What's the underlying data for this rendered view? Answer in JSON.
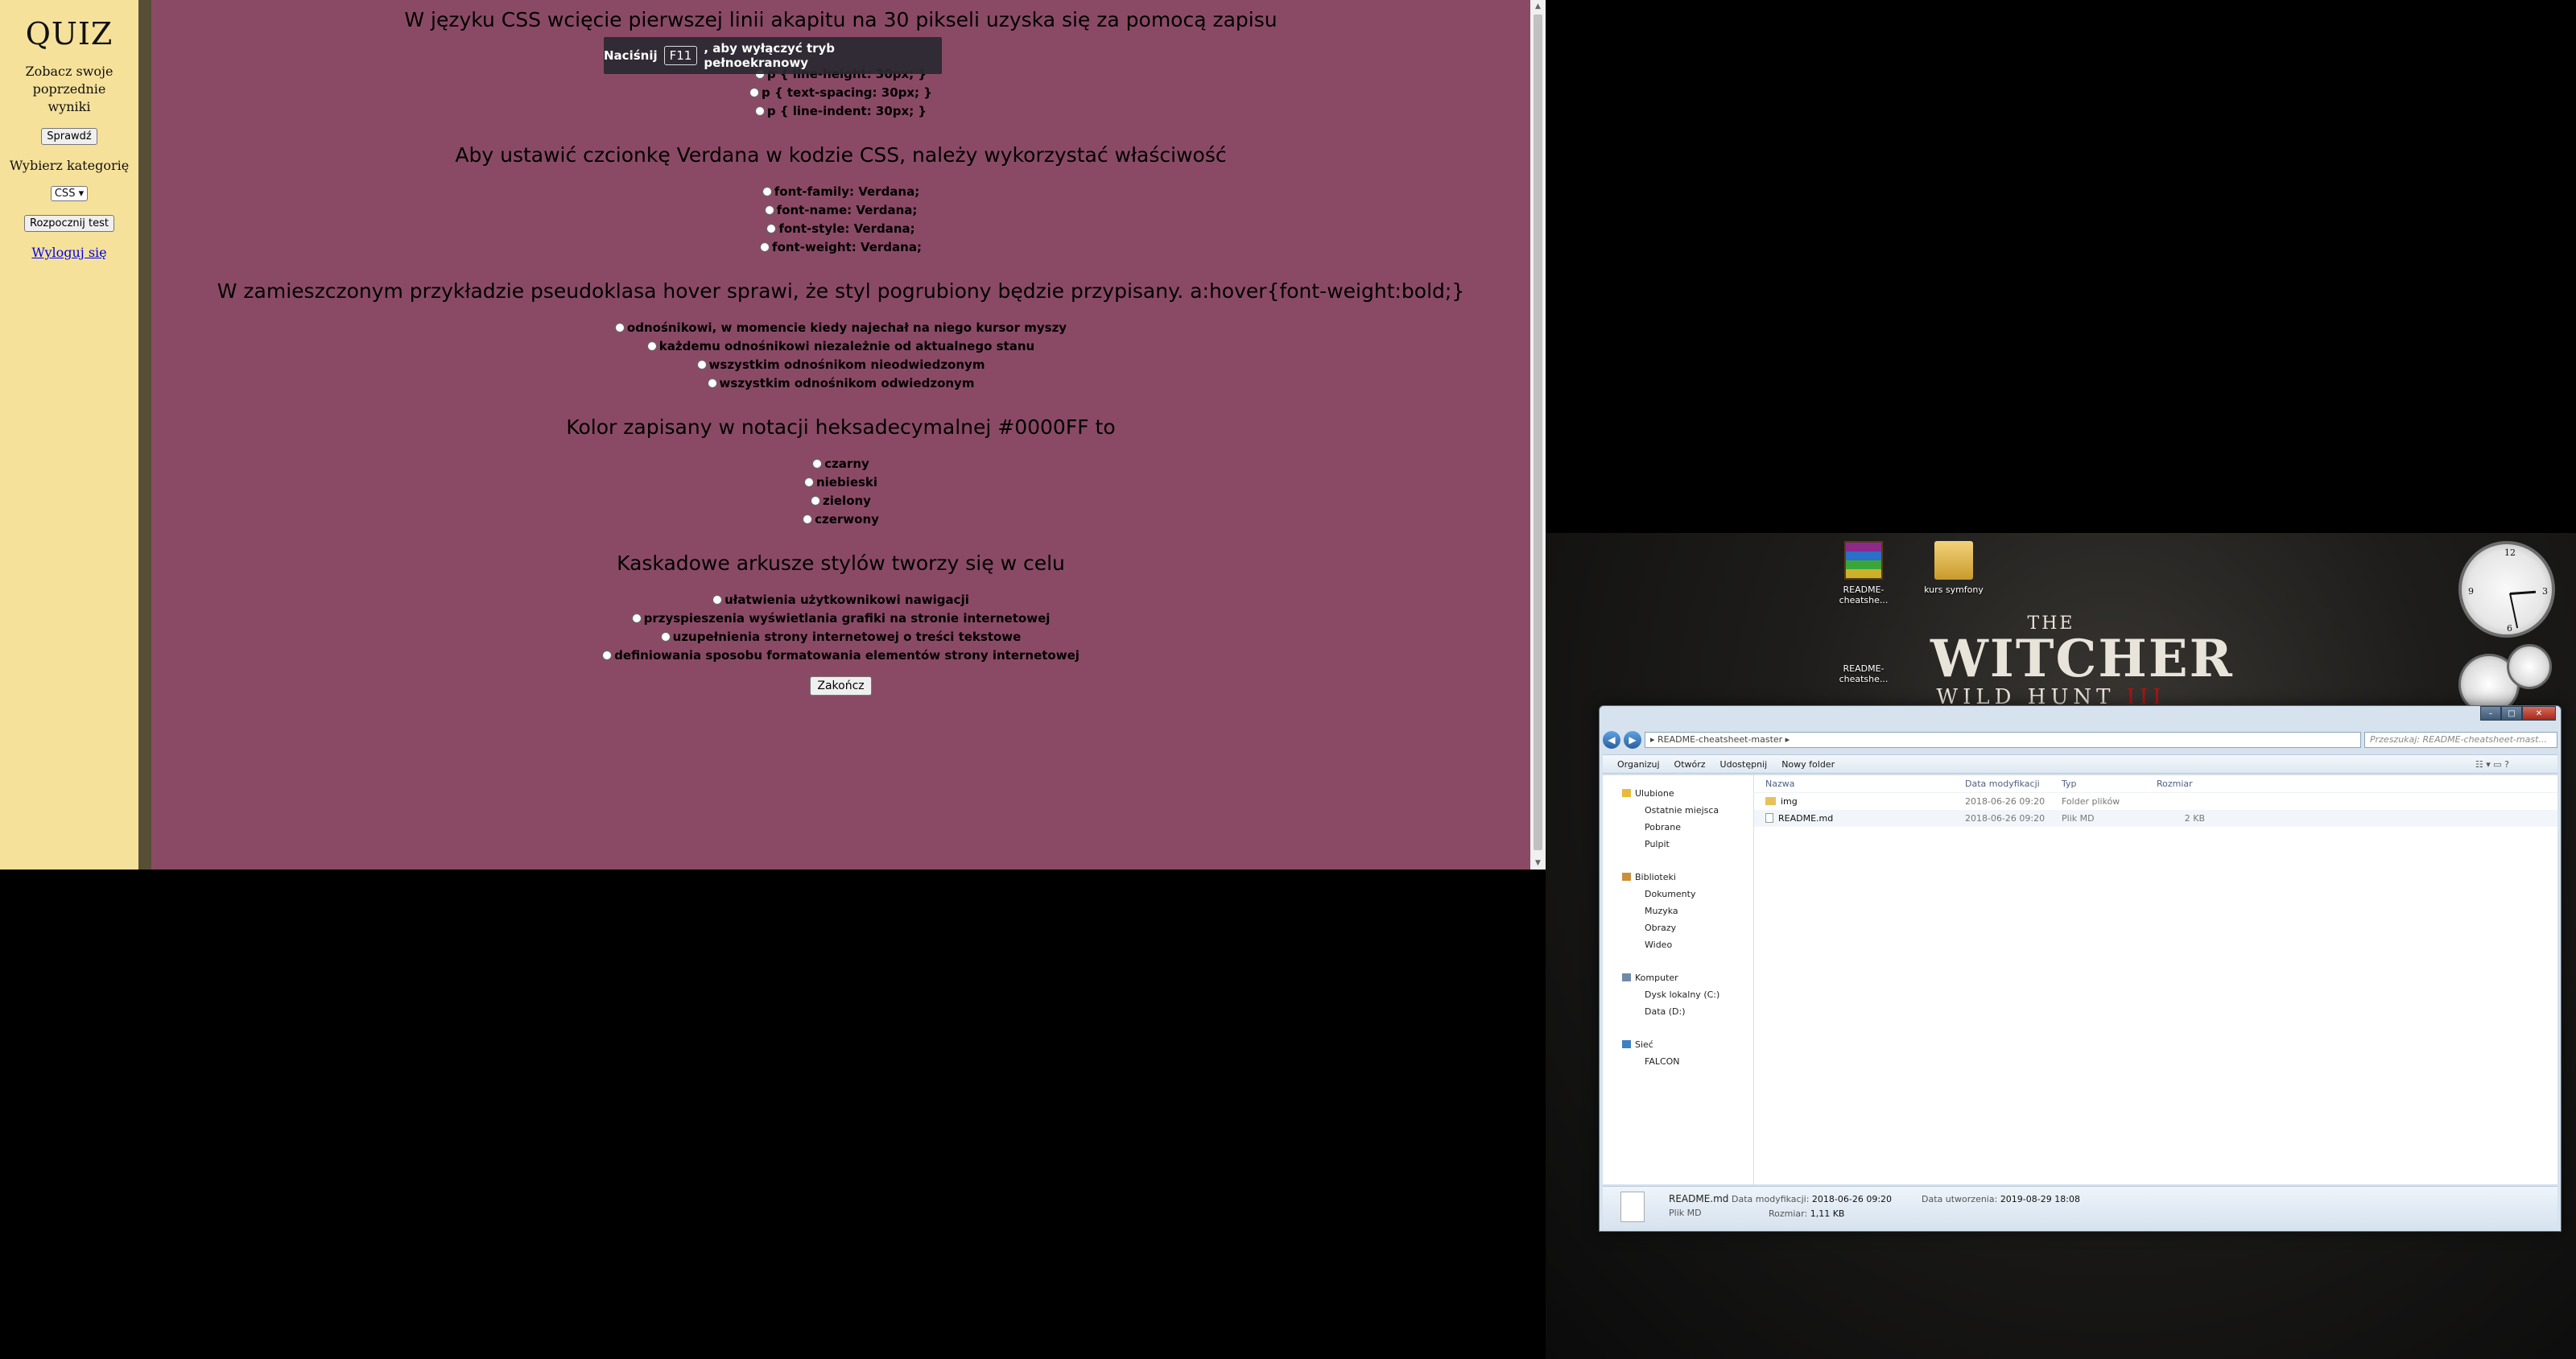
{
  "sidebar": {
    "title": "QUIZ",
    "previous_results": "Zobacz swoje poprzednie wyniki",
    "check_button": "Sprawdź",
    "category_label": "Wybierz kategorię",
    "category_value": "CSS",
    "start_button": "Rozpocznij test",
    "logout_link": "Wyloguj się"
  },
  "fullscreen_toast": {
    "before": "Naciśnij",
    "key": "F11",
    "after": ", aby wyłączyć tryb pełnoekranowy"
  },
  "questions": [
    {
      "text": "W języku CSS wcięcie pierwszej linii akapitu na 30 pikseli uzyska się za pomocą zapisu",
      "options": [
        "p { line-height: 30px; }",
        "p { text-spacing: 30px; }",
        "p { line-indent: 30px; }"
      ]
    },
    {
      "text": "Aby ustawić czcionkę Verdana w kodzie CSS, należy wykorzystać właściwość",
      "options": [
        "font-family: Verdana;",
        "font-name: Verdana;",
        "font-style: Verdana;",
        "font-weight: Verdana;"
      ]
    },
    {
      "text": "W zamieszczonym przykładzie pseudoklasa hover sprawi, że styl pogrubiony będzie przypisany. a:hover{font-weight:bold;}",
      "options": [
        "odnośnikowi, w momencie kiedy najechał na niego kursor myszy",
        "każdemu odnośnikowi niezależnie od aktualnego stanu",
        "wszystkim odnośnikom nieodwiedzonym",
        "wszystkim odnośnikom odwiedzonym"
      ]
    },
    {
      "text": "Kolor zapisany w notacji heksadecymalnej #0000FF to",
      "options": [
        "czarny",
        "niebieski",
        "zielony",
        "czerwony"
      ]
    },
    {
      "text": "Kaskadowe arkusze stylów tworzy się w celu",
      "options": [
        "ułatwienia użytkownikowi nawigacji",
        "przyspieszenia wyświetlania grafiki na stronie internetowej",
        "uzupełnienia strony internetowej o treści tekstowe",
        "definiowania sposobu formatowania elementów strony internetowej"
      ]
    }
  ],
  "finish_button": "Zakończ",
  "desktop": {
    "icons": [
      {
        "label": "README-cheatshe...",
        "icon": "winrar-archive-icon"
      },
      {
        "label": "kurs symfony",
        "icon": "folder-icon"
      },
      {
        "label": "README-cheatshe...",
        "icon": "file-icon"
      }
    ],
    "wallpaper": {
      "the": "THE",
      "main_before": "WITCHER",
      "sub": "WILD HUNT",
      "three": "III"
    },
    "clock": {
      "time": "3:28"
    }
  },
  "explorer": {
    "address": "README-cheatsheet-master",
    "search_placeholder": "Przeszukaj: README-cheatsheet-mast...",
    "toolbar": [
      "Organizuj",
      "Otwórz",
      "Udostępnij",
      "Nowy folder"
    ],
    "nav": {
      "favorites": {
        "label": "Ulubione",
        "items": [
          "Ostatnie miejsca",
          "Pobrane",
          "Pulpit"
        ]
      },
      "libraries": {
        "label": "Biblioteki",
        "items": [
          "Dokumenty",
          "Muzyka",
          "Obrazy",
          "Wideo"
        ]
      },
      "computer": {
        "label": "Komputer",
        "items": [
          "Dysk lokalny (C:)",
          "Data (D:)"
        ]
      },
      "network": {
        "label": "Sieć",
        "items": [
          "FALCON"
        ]
      }
    },
    "columns": [
      "Nazwa",
      "Data modyfikacji",
      "Typ",
      "Rozmiar"
    ],
    "files": [
      {
        "name": "img",
        "modified": "2018-06-26 09:20",
        "type": "Folder plików",
        "size": ""
      },
      {
        "name": "README.md",
        "modified": "2018-06-26 09:20",
        "type": "Plik MD",
        "size": "2 KB"
      }
    ],
    "details": {
      "name": "README.md",
      "type": "Plik MD",
      "modified_label": "Data modyfikacji:",
      "modified": "2018-06-26 09:20",
      "size_label": "Rozmiar:",
      "size": "1,11 KB",
      "created_label": "Data utworzenia:",
      "created": "2019-08-29 18:08"
    }
  }
}
